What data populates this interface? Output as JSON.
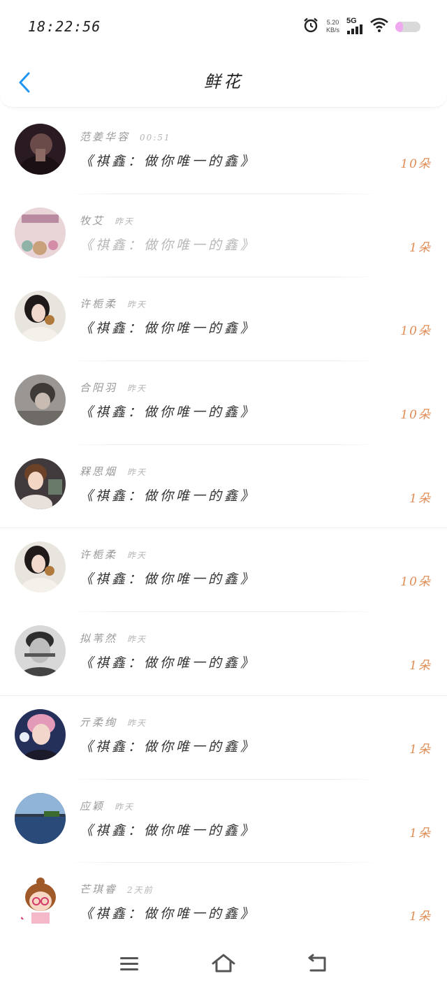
{
  "status_bar": {
    "time": "18:22:56",
    "net_speed_value": "5.20",
    "net_speed_unit": "KB/s",
    "network_type": "5G",
    "battery_level": 0.3,
    "icons": [
      "alarm-icon",
      "signal-icon",
      "wifi-icon",
      "battery-icon"
    ]
  },
  "header": {
    "title": "鲜花",
    "back_icon": "chevron-left-icon",
    "accent_color": "#2196f3"
  },
  "list": [
    {
      "name": "范姜华容",
      "time": "00:51",
      "message": "《祺鑫：做你唯一的鑫》",
      "count": "10朵",
      "avatar": "dark-portrait"
    },
    {
      "name": "牧艾",
      "time": "昨天",
      "message": "《祺鑫：做你唯一的鑫》",
      "count": "1朵",
      "avatar": "party-photo"
    },
    {
      "name": "许栀柔",
      "time": "昨天",
      "message": "《祺鑫：做你唯一的鑫》",
      "count": "10朵",
      "avatar": "girl-portrait"
    },
    {
      "name": "合阳羽",
      "time": "昨天",
      "message": "《祺鑫：做你唯一的鑫》",
      "count": "10朵",
      "avatar": "grey-portrait"
    },
    {
      "name": "槑思烟",
      "time": "昨天",
      "message": "《祺鑫：做你唯一的鑫》",
      "count": "1朵",
      "avatar": "illustration-portrait"
    },
    {
      "name": "许栀柔",
      "time": "昨天",
      "message": "《祺鑫：做你唯一的鑫》",
      "count": "10朵",
      "avatar": "girl-portrait"
    },
    {
      "name": "拟苇然",
      "time": "昨天",
      "message": "《祺鑫：做你唯一的鑫》",
      "count": "1朵",
      "avatar": "bw-portrait"
    },
    {
      "name": "亓柔绚",
      "time": "昨天",
      "message": "《祺鑫：做你唯一的鑫》",
      "count": "1朵",
      "avatar": "pink-hair-portrait"
    },
    {
      "name": "应颖",
      "time": "昨天",
      "message": "《祺鑫：做你唯一的鑫》",
      "count": "1朵",
      "avatar": "landscape"
    },
    {
      "name": "芒琪睿",
      "time": "2天前",
      "message": "《祺鑫：做你唯一的鑫》",
      "count": "1朵",
      "avatar": "cartoon-girl"
    }
  ],
  "colors": {
    "count": "#e08d55",
    "name": "#9a9a9a",
    "message": "#333333"
  },
  "bottom_nav": {
    "icons": [
      "menu-icon",
      "home-icon",
      "back-return-icon"
    ]
  }
}
